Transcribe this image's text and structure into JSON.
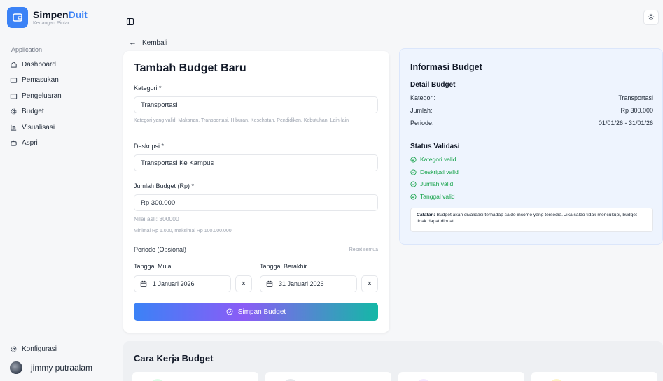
{
  "brand": {
    "name_part1": "Simpen",
    "name_part2": "Duit",
    "tagline": "Keuangan Pintar",
    "color": "#3b82f6"
  },
  "sidebar": {
    "group_label": "Application",
    "items": [
      {
        "label": "Dashboard",
        "icon": "home-icon"
      },
      {
        "label": "Pemasukan",
        "icon": "wallet-icon"
      },
      {
        "label": "Pengeluaran",
        "icon": "wallet-icon"
      },
      {
        "label": "Budget",
        "icon": "gear-icon"
      },
      {
        "label": "Visualisasi",
        "icon": "chart-bars-icon"
      },
      {
        "label": "Aspri",
        "icon": "robot-icon"
      }
    ],
    "bottom_item": {
      "label": "Konfigurasi",
      "icon": "gear-icon"
    },
    "user": {
      "name": "jimmy putraalam"
    }
  },
  "header": {
    "back_label": "Kembali"
  },
  "form": {
    "title": "Tambah Budget Baru",
    "kategori_label": "Kategori *",
    "kategori_value": "Transportasi",
    "kategori_hint": "Kategori yang valid: Makanan, Transportasi, Hiburan, Kesehatan, Pendidikan, Kebutuhan, Lain-lain",
    "deskripsi_label": "Deskripsi *",
    "deskripsi_value": "Transportasi Ke Kampus",
    "jumlah_label": "Jumlah Budget (Rp) *",
    "jumlah_value": "Rp 300.000",
    "nilai_asli": "Nilai asli: 300000",
    "jumlah_hint": "Minimal Rp 1.000, maksimal Rp 100.000.000",
    "periode_label": "Periode (Opsional)",
    "reset_label": "Reset semua",
    "start_label": "Tanggal Mulai",
    "start_value": "1 Januari 2026",
    "end_label": "Tanggal Berakhir",
    "end_value": "31 Januari 2026",
    "clear_symbol": "×",
    "save_label": "Simpan Budget"
  },
  "info": {
    "title": "Informasi Budget",
    "detail_title": "Detail Budget",
    "rows": [
      {
        "key": "Kategori:",
        "value": "Transportasi"
      },
      {
        "key": "Jumlah:",
        "value": "Rp 300.000"
      },
      {
        "key": "Periode:",
        "value": "01/01/26 - 31/01/26"
      }
    ],
    "status_title": "Status Validasi",
    "validations": [
      "Kategori valid",
      "Deskripsi valid",
      "Jumlah valid",
      "Tanggal valid"
    ],
    "note_label": "Catatan:",
    "note_text": " Budget akan divalidasi terhadap saldo income yang tersedia. Jika saldo tidak mencukupi, budget tidak dapat dibuat."
  },
  "how": {
    "title": "Cara Kerja Budget"
  },
  "colors": {
    "accent": "#3b82f6",
    "valid": "#16a34a",
    "info_bg": "#eef4fe"
  }
}
